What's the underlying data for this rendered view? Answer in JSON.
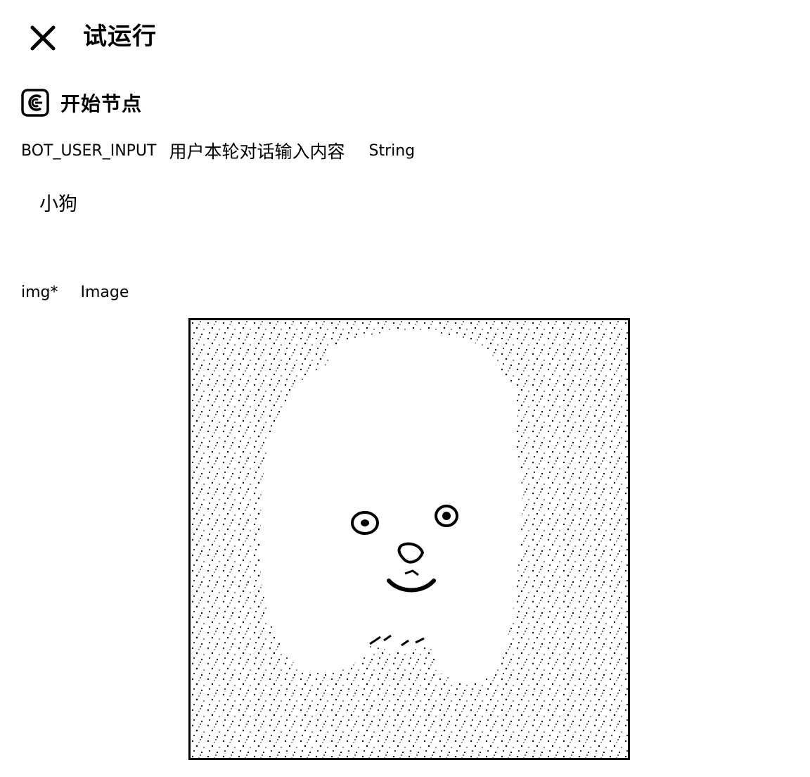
{
  "header": {
    "title": "试运行",
    "close_icon": "close-icon"
  },
  "node": {
    "icon": "start-node-icon",
    "title": "开始节点"
  },
  "params": [
    {
      "name": "BOT_USER_INPUT",
      "description": "用户本轮对话输入内容",
      "type": "String",
      "value": "小狗"
    },
    {
      "name": "img*",
      "type": "Image"
    }
  ]
}
